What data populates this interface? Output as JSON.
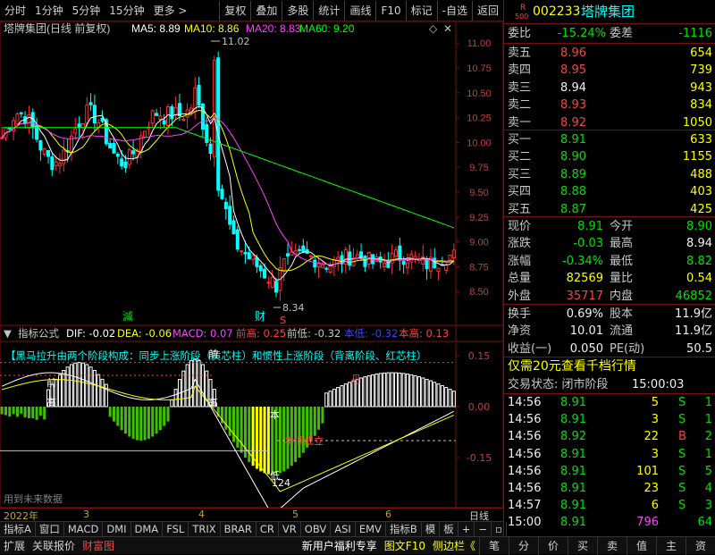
{
  "topbar": {
    "items": [
      "分时",
      "1分钟",
      "5分钟",
      "15分钟",
      "更多 >",
      "复权",
      "叠加",
      "多股",
      "统计",
      "画线",
      "F10",
      "标记",
      "-自选",
      "返回"
    ]
  },
  "main_chart": {
    "title": "塔牌集团(日线 前复权)",
    "ma5_label": "MA5: 8.89",
    "ma10_label": "MA10: 8.86",
    "ma20_label": "MA20: 8.83",
    "ma60_label": "MA60: 9.20",
    "high_mark": "11.02",
    "low_mark": "8.34",
    "label_jian": "減",
    "label_cai": "财",
    "label_s": "S",
    "price_axis": [
      "11.00",
      "10.75",
      "10.50",
      "10.25",
      "10.00",
      "9.75",
      "9.50",
      "9.25",
      "9.00",
      "8.75",
      "8.50"
    ],
    "colors": {
      "up": "#ff3030",
      "down": "#00ffff",
      "ma5": "#ffffff",
      "ma10": "#ffff00",
      "ma20": "#ff40ff",
      "ma60": "#00ff00"
    }
  },
  "indicator": {
    "name": "指标公式",
    "dif": "DIF: -0.02",
    "dea": "DEA: -0.06",
    "macd": "MACD: 0.07",
    "qiangao": "前高: 0.25",
    "qiandi": "前低: -0.32",
    "benjiao": "本低: -0.32",
    "bengao": "本高: 0.13",
    "banner": "【黑马拉升由两个阶段构成：同步上涨阶段（黄芯柱）和惯性上涨阶段（背离阶段、红芯柱）",
    "axis": [
      "0.15",
      "0.00",
      "-0.15"
    ],
    "marks": {
      "qian": "前",
      "gao": "高",
      "ben": "本",
      "di": "低",
      "num": "124",
      "cheng": "本低成立",
      "dan": "丹"
    },
    "footnote": "用到未来数据"
  },
  "date_axis": [
    "2022年",
    "3",
    "4",
    "5",
    "6"
  ],
  "date_axis_right": "日线",
  "tabs1": [
    "指标A",
    "窗口",
    "MACD",
    "DMI",
    "DMA",
    "FSL",
    "TRIX",
    "BRAR",
    "CR",
    "VR",
    "OBV",
    "ASI",
    "EMV",
    "指标B",
    "模",
    "板",
    "+",
    "−",
    "▫"
  ],
  "tabs2": [
    "扩展",
    "关联报价",
    "财富图",
    "新用户福利专享",
    "图文F10",
    "侧边栏《",
    "笔",
    "分",
    "价",
    "买",
    "卖",
    "值",
    "主",
    "资"
  ],
  "panel": {
    "code": "002233",
    "name": "塔牌集团",
    "r_badge": "R",
    "num_badge": "500",
    "weibi_label": "委比",
    "weibi": "-15.24%",
    "weicha_label": "委差",
    "weicha": "-1116",
    "sell": [
      {
        "label": "卖五",
        "price": "8.96",
        "vol": "654"
      },
      {
        "label": "卖四",
        "price": "8.95",
        "vol": "739"
      },
      {
        "label": "卖三",
        "price": "8.94",
        "vol": "943"
      },
      {
        "label": "卖二",
        "price": "8.93",
        "vol": "834"
      },
      {
        "label": "卖一",
        "price": "8.92",
        "vol": "1050"
      }
    ],
    "buy": [
      {
        "label": "买一",
        "price": "8.91",
        "vol": "633"
      },
      {
        "label": "买二",
        "price": "8.90",
        "vol": "1155"
      },
      {
        "label": "买三",
        "price": "8.89",
        "vol": "488"
      },
      {
        "label": "买四",
        "price": "8.88",
        "vol": "403"
      },
      {
        "label": "买五",
        "price": "8.87",
        "vol": "425"
      }
    ],
    "stats": [
      {
        "l1": "现价",
        "v1": "8.91",
        "c1": "green",
        "l2": "今开",
        "v2": "8.90",
        "c2": "green"
      },
      {
        "l1": "涨跌",
        "v1": "-0.03",
        "c1": "green",
        "l2": "最高",
        "v2": "8.94",
        "c2": "white"
      },
      {
        "l1": "涨幅",
        "v1": "-0.34%",
        "c1": "green",
        "l2": "最低",
        "v2": "8.82",
        "c2": "green"
      },
      {
        "l1": "总量",
        "v1": "82569",
        "c1": "yellow",
        "l2": "量比",
        "v2": "0.54",
        "c2": "yellow"
      },
      {
        "l1": "外盘",
        "v1": "35717",
        "c1": "red",
        "l2": "内盘",
        "v2": "46852",
        "c2": "green"
      }
    ],
    "stats2": [
      {
        "l1": "换手",
        "v1": "0.69%",
        "l2": "股本",
        "v2": "11.9亿"
      },
      {
        "l1": "净资",
        "v1": "10.01",
        "l2": "流通",
        "v2": "11.9亿"
      },
      {
        "l1": "收益(一)",
        "v1": "0.050",
        "l2": "PE(动)",
        "v2": "50.5"
      }
    ],
    "promo": "仅需20元查看千档行情",
    "status_label": "交易状态: 闭市阶段",
    "status_time": "15:00:03",
    "ticks": [
      {
        "time": "14:56",
        "price": "8.91",
        "vol": "5",
        "bs": "S",
        "n": "1",
        "bsc": "green",
        "vc": "yellow"
      },
      {
        "time": "14:56",
        "price": "8.91",
        "vol": "3",
        "bs": "S",
        "n": "1",
        "bsc": "green",
        "vc": "yellow"
      },
      {
        "time": "14:56",
        "price": "8.92",
        "vol": "22",
        "bs": "B",
        "n": "2",
        "bsc": "red",
        "vc": "yellow"
      },
      {
        "time": "14:56",
        "price": "8.91",
        "vol": "3",
        "bs": "S",
        "n": "1",
        "bsc": "green",
        "vc": "yellow"
      },
      {
        "time": "14:56",
        "price": "8.91",
        "vol": "101",
        "bs": "S",
        "n": "5",
        "bsc": "green",
        "vc": "yellow"
      },
      {
        "time": "14:56",
        "price": "8.91",
        "vol": "23",
        "bs": "S",
        "n": "4",
        "bsc": "green",
        "vc": "yellow"
      },
      {
        "time": "14:57",
        "price": "8.91",
        "vol": "6",
        "bs": "S",
        "n": "3",
        "bsc": "green",
        "vc": "yellow"
      },
      {
        "time": "15:00",
        "price": "8.91",
        "vol": "796",
        "bs": "",
        "n": "64",
        "bsc": "green",
        "vc": "magenta"
      }
    ]
  }
}
